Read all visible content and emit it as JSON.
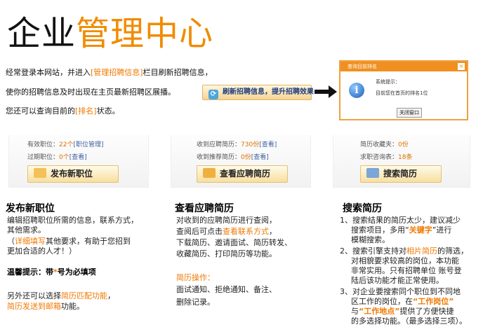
{
  "title": {
    "part1": "企业",
    "part2": "管理中心"
  },
  "intro": {
    "line1_a": "经常登录本网站，并进入",
    "line1_hl": "[管理招聘信息]",
    "line1_b": "栏目刷新招聘信息，",
    "line2": "使你的招聘信息及时出现在主页最新招聘区展播。",
    "line3_a": "您还可以查询目前的",
    "line3_hl": "[排名]",
    "line3_b": "状态。"
  },
  "refresh_button": {
    "label": "刷新招聘信息，提升招聘效果"
  },
  "dialog": {
    "title": "查询目前排名",
    "close": "×",
    "label": "系统提示：",
    "message": "目前您在首页的排名1位",
    "close_button": "关闭窗口"
  },
  "panels": {
    "publish": {
      "row1_label": "有效职位：",
      "row1_value": "22个",
      "row1_link": "[职位管理]",
      "row2_label": "过期职位：",
      "row2_value": "0个",
      "row2_link": "[查看]",
      "button": "发布新职位"
    },
    "resumes": {
      "row1_label": "收到应聘简历：",
      "row1_value": "730份",
      "row1_link": "[查看]",
      "row2_label": "收到推荐简历：",
      "row2_value": "0份",
      "row2_link": "[查看]",
      "button": "查看应聘简历"
    },
    "search": {
      "row1_label": "简历收藏夹：",
      "row1_value": "0份",
      "row2_label": "求职咨询表：",
      "row2_value": "18条",
      "button": "搜索简历"
    }
  },
  "sections": {
    "publish": {
      "heading": "发布新职位",
      "l1": "编辑招聘职位所需的信息，联系方式，",
      "l2": "其他需求。",
      "l3_a": "（",
      "l3_hl": "详细填写",
      "l3_b": "其他要求，有助于您招到",
      "l4": "更加合适的人才！）",
      "tip_a": "温馨提示：带",
      "tip_star": "*",
      "tip_b": "号为必填项",
      "l5": "另外还可以选择",
      "l5_hl": "简历匹配功能",
      "l5_b": "，",
      "l6_hl": "简历发送到邮箱",
      "l6_b": "功能。"
    },
    "resumes": {
      "heading": "查看应聘简历",
      "l1": "对收到的应聘简历进行查阅，",
      "l2_a": "查阅后可点击",
      "l2_hl": "查看联系方式",
      "l2_b": "，",
      "l3": "下载简历、邀请面试、简历转发、",
      "l4": "收藏简历、打印简历等功能。",
      "op_heading": "简历操作：",
      "op1": "面试通知、拒绝通知、备注、",
      "op2": "删除记录。"
    },
    "search": {
      "heading": "搜索简历",
      "i1_a": "1、搜索结果的简历太少，建议减少",
      "i1_b": "搜索项目，多用“",
      "i1_hl": "关键字",
      "i1_c": "”进行",
      "i1_d": "模糊搜索。",
      "i2_a": "2、搜索引擎支持对",
      "i2_hl": "相片简历",
      "i2_b": "的筛选，",
      "i2_c": "对相貌要求较高的岗位，本功能",
      "i2_d": "非常实用。只有招聘单位 账号登",
      "i2_e": "陆后该功能才能正常使用。",
      "i3_a": "3、对企业要搜索同个职位到不同地",
      "i3_b": "区工作的岗位，在",
      "i3_hl1": "“工作岗位”",
      "i3_c": "与",
      "i3_hl2": "“工作地点”",
      "i3_d": "提供了方便快捷",
      "i3_e": "的多选择功能。（最多选择三项）。"
    }
  }
}
